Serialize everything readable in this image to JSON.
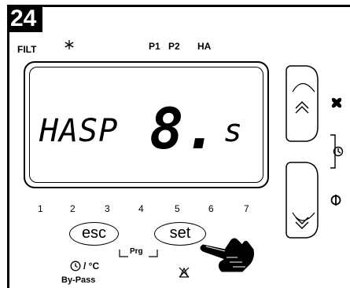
{
  "panel": {
    "step_number": "24",
    "indicators": {
      "filt": "FILT",
      "p1": "P1",
      "p2": "P2",
      "ha": "HA"
    },
    "display": {
      "param_code": "HASP",
      "value": "8.",
      "unit": "s"
    },
    "scale_numbers": [
      "1",
      "2",
      "3",
      "4",
      "5",
      "6",
      "7"
    ],
    "keys": {
      "esc": "esc",
      "set": "set"
    },
    "labels": {
      "prg": "Prg",
      "temp": "/ °C",
      "bypass": "By-Pass"
    }
  },
  "icons": [
    "snowflake-icon",
    "fan-icon",
    "clock-icon",
    "power-icon",
    "up-chevron-icon",
    "down-chevron-icon",
    "hand-pointer-icon",
    "no-fan-icon"
  ]
}
